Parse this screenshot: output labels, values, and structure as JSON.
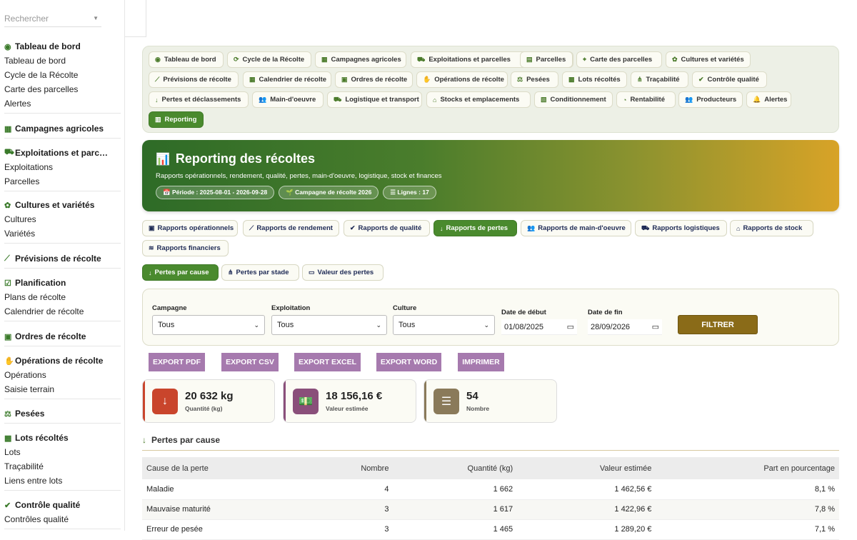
{
  "sidebar": {
    "search_placeholder": "Rechercher",
    "groups": [
      {
        "title": "Tableau de bord",
        "icon": "dashboard-icon",
        "items": [
          "Tableau de bord",
          "Cycle de la Récolte",
          "Carte des parcelles",
          "Alertes"
        ]
      },
      {
        "title": "Campagnes agricoles",
        "icon": "calendar-icon",
        "items": []
      },
      {
        "title": "Exploitations et parc…",
        "icon": "tractor-icon",
        "items": [
          "Exploitations",
          "Parcelles"
        ]
      },
      {
        "title": "Cultures et variétés",
        "icon": "seedling-icon",
        "items": [
          "Cultures",
          "Variétés"
        ]
      },
      {
        "title": "Prévisions de récolte",
        "icon": "chart-line-icon",
        "items": []
      },
      {
        "title": "Planification",
        "icon": "calendar-check-icon",
        "items": [
          "Plans de récolte",
          "Calendrier de récolte"
        ]
      },
      {
        "title": "Ordres de récolte",
        "icon": "clipboard-icon",
        "items": []
      },
      {
        "title": "Opérations de récolte",
        "icon": "hand-icon",
        "items": [
          "Opérations",
          "Saisie terrain"
        ]
      },
      {
        "title": "Pesées",
        "icon": "scale-icon",
        "items": []
      },
      {
        "title": "Lots récoltés",
        "icon": "boxes-icon",
        "items": [
          "Lots",
          "Traçabilité",
          "Liens entre lots"
        ]
      },
      {
        "title": "Contrôle qualité",
        "icon": "quality-icon",
        "items": [
          "Contrôles qualité"
        ]
      }
    ]
  },
  "nav": [
    {
      "label": "Tableau de bord",
      "icon": "dashboard-icon"
    },
    {
      "label": "Cycle de la Récolte",
      "icon": "sync-icon"
    },
    {
      "label": "Campagnes agricoles",
      "icon": "calendar-icon"
    },
    {
      "label": "Exploitations et parcelles",
      "icon": "tractor-icon"
    },
    {
      "label": "Parcelles",
      "icon": "map-icon"
    },
    {
      "label": "Carte des parcelles",
      "icon": "map-marker-icon"
    },
    {
      "label": "Cultures et variétés",
      "icon": "seedling-icon"
    },
    {
      "label": "Prévisions de récolte",
      "icon": "chart-line-icon"
    },
    {
      "label": "Calendrier de récolte",
      "icon": "calendar-icon"
    },
    {
      "label": "Ordres de récolte",
      "icon": "clipboard-icon"
    },
    {
      "label": "Opérations de récolte",
      "icon": "hand-icon"
    },
    {
      "label": "Pesées",
      "icon": "scale-icon"
    },
    {
      "label": "Lots récoltés",
      "icon": "boxes-icon"
    },
    {
      "label": "Traçabilité",
      "icon": "network-icon"
    },
    {
      "label": "Contrôle qualité",
      "icon": "quality-icon"
    },
    {
      "label": "Pertes et déclassements",
      "icon": "arrow-down-icon"
    },
    {
      "label": "Main-d'oeuvre",
      "icon": "users-icon"
    },
    {
      "label": "Logistique et transport",
      "icon": "truck-icon"
    },
    {
      "label": "Stocks et emplacements",
      "icon": "warehouse-icon"
    },
    {
      "label": "Conditionnement",
      "icon": "package-icon"
    },
    {
      "label": "Rentabilité",
      "icon": "pie-chart-icon"
    },
    {
      "label": "Producteurs",
      "icon": "users-icon"
    },
    {
      "label": "Alertes",
      "icon": "bell-icon"
    },
    {
      "label": "Reporting",
      "icon": "chart-bar-icon",
      "active": true
    }
  ],
  "hero": {
    "title": "Reporting des récoltes",
    "subtitle": "Rapports opérationnels, rendement, qualité, pertes, main-d'oeuvre, logistique, stock et finances",
    "chips": [
      "Période : 2025-08-01 - 2026-09-28",
      "Campagne de récolte 2026",
      "Lignes : 17"
    ]
  },
  "report_tabs": [
    {
      "label": "Rapports opérationnels",
      "icon": "clipboard-icon"
    },
    {
      "label": "Rapports de rendement",
      "icon": "chart-line-icon"
    },
    {
      "label": "Rapports de qualité",
      "icon": "quality-icon"
    },
    {
      "label": "Rapports de pertes",
      "icon": "arrow-down-icon",
      "active": true
    },
    {
      "label": "Rapports de main-d'oeuvre",
      "icon": "users-icon"
    },
    {
      "label": "Rapports logistiques",
      "icon": "truck-icon"
    },
    {
      "label": "Rapports de stock",
      "icon": "warehouse-icon"
    },
    {
      "label": "Rapports financiers",
      "icon": "coins-icon"
    }
  ],
  "sub_tabs": [
    {
      "label": "Pertes par cause",
      "icon": "arrow-down-icon",
      "active": true
    },
    {
      "label": "Pertes par stade",
      "icon": "network-icon"
    },
    {
      "label": "Valeur des pertes",
      "icon": "money-icon"
    }
  ],
  "filters": {
    "campagne_label": "Campagne",
    "campagne_value": "Tous",
    "exploitation_label": "Exploitation",
    "exploitation_value": "Tous",
    "culture_label": "Culture",
    "culture_value": "Tous",
    "date_debut_label": "Date de début",
    "date_debut_value": "01/08/2025",
    "date_fin_label": "Date de fin",
    "date_fin_value": "28/09/2026",
    "submit": "FILTRER"
  },
  "exports": [
    "EXPORT PDF",
    "EXPORT CSV",
    "EXPORT EXCEL",
    "EXPORT WORD",
    "IMPRIMER"
  ],
  "cards": [
    {
      "value": "20 632 kg",
      "label": "Quantité (kg)",
      "icon": "arrow-down-icon",
      "color": "#c9452c"
    },
    {
      "value": "18 156,16 €",
      "label": "Valeur estimée",
      "icon": "money-icon",
      "color": "#8a4f7a"
    },
    {
      "value": "54",
      "label": "Nombre",
      "icon": "list-icon",
      "color": "#8a7a5a"
    }
  ],
  "section_title": "Pertes par cause",
  "table": {
    "headers": [
      "Cause de la perte",
      "Nombre",
      "Quantité (kg)",
      "Valeur estimée",
      "Part en pourcentage"
    ],
    "rows": [
      [
        "Maladie",
        "4",
        "1 662",
        "1 462,56 €",
        "8,1 %"
      ],
      [
        "Mauvaise maturité",
        "3",
        "1 617",
        "1 422,96 €",
        "7,8 %"
      ],
      [
        "Erreur de pesée",
        "3",
        "1 465",
        "1 289,20 €",
        "7,1 %"
      ]
    ]
  }
}
